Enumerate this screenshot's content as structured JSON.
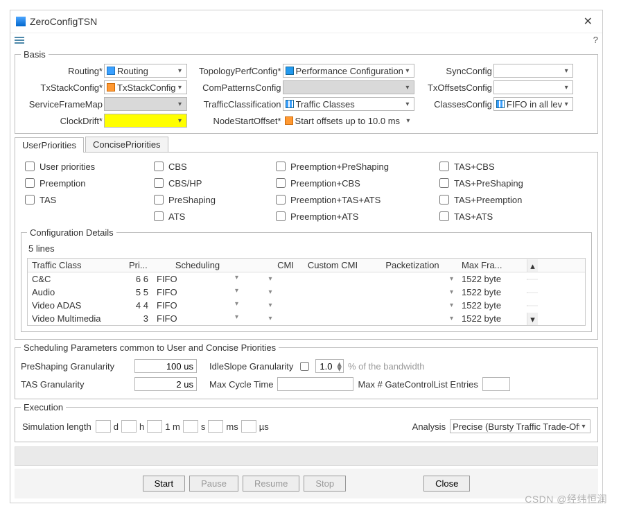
{
  "window": {
    "title": "ZeroConfigTSN",
    "close": "✕",
    "help": "?"
  },
  "basis": {
    "legend": "Basis",
    "fields": {
      "routing": {
        "label": "Routing*",
        "value": "Routing"
      },
      "topo": {
        "label": "TopologyPerfConfig*",
        "value": "Performance Configuration"
      },
      "sync": {
        "label": "SyncConfig",
        "value": ""
      },
      "txstack": {
        "label": "TxStackConfig*",
        "value": "TxStackConfig"
      },
      "compat": {
        "label": "ComPatternsConfig",
        "value": ""
      },
      "txoff": {
        "label": "TxOffsetsConfig",
        "value": ""
      },
      "sfm": {
        "label": "ServiceFrameMap",
        "value": ""
      },
      "traf": {
        "label": "TrafficClassification",
        "value": "Traffic Classes"
      },
      "classes": {
        "label": "ClassesConfig",
        "value": "FIFO in all lev"
      },
      "clock": {
        "label": "ClockDrift*",
        "value": ""
      },
      "nodeoff": {
        "label": "NodeStartOffset*",
        "value": "Start offsets up to 10.0 ms"
      }
    }
  },
  "tabs": {
    "user": "UserPriorities",
    "concise": "ConcisePriorities"
  },
  "checks": {
    "c1": [
      "User priorities",
      "Preemption",
      "TAS"
    ],
    "c2": [
      "CBS",
      "CBS/HP",
      "PreShaping",
      "ATS"
    ],
    "c3": [
      "Preemption+PreShaping",
      "Preemption+CBS",
      "Preemption+TAS+ATS",
      "Preemption+ATS"
    ],
    "c4": [
      "TAS+CBS",
      "TAS+PreShaping",
      "TAS+Preemption",
      "TAS+ATS"
    ]
  },
  "details": {
    "legend": "Configuration Details",
    "count": "5  lines",
    "headers": {
      "tc": "Traffic Class",
      "pri": "Pri...",
      "sched": "Scheduling",
      "cmi": "CMI",
      "ccmi": "Custom CMI",
      "pkt": "Packetization",
      "max": "Max Fra..."
    },
    "rows": [
      {
        "tc": "C&C",
        "pri": "6 6",
        "sched": "FIFO",
        "max": "1522 byte"
      },
      {
        "tc": "Audio",
        "pri": "5 5",
        "sched": "FIFO",
        "max": "1522 byte"
      },
      {
        "tc": "Video ADAS",
        "pri": "4 4",
        "sched": "FIFO",
        "max": "1522 byte"
      },
      {
        "tc": "Video Multimedia",
        "pri": "3",
        "sched": "FIFO",
        "max": "1522 byte"
      }
    ]
  },
  "sched": {
    "legend": "Scheduling Parameters common to User and Concise Priorities",
    "preshape_lbl": "PreShaping Granularity",
    "preshape_val": "100 us",
    "idle_lbl": "IdleSlope Granularity",
    "idle_val": "1.0",
    "idle_note": "% of the bandwidth",
    "tas_lbl": "TAS Granularity",
    "tas_val": "2 us",
    "maxcycle_lbl": "Max Cycle Time",
    "maxcycle_val": "",
    "maxgate_lbl": "Max # GateControlList Entries",
    "maxgate_val": ""
  },
  "exec": {
    "legend": "Execution",
    "simlen": "Simulation length",
    "units": [
      "d",
      "h",
      "1 m",
      "s",
      "ms",
      "µs"
    ],
    "analysis_lbl": "Analysis",
    "analysis_val": "Precise (Bursty Traffic Trade-Off)"
  },
  "buttons": {
    "start": "Start",
    "pause": "Pause",
    "resume": "Resume",
    "stop": "Stop",
    "close": "Close"
  },
  "watermark": "CSDN @经纬恒润"
}
